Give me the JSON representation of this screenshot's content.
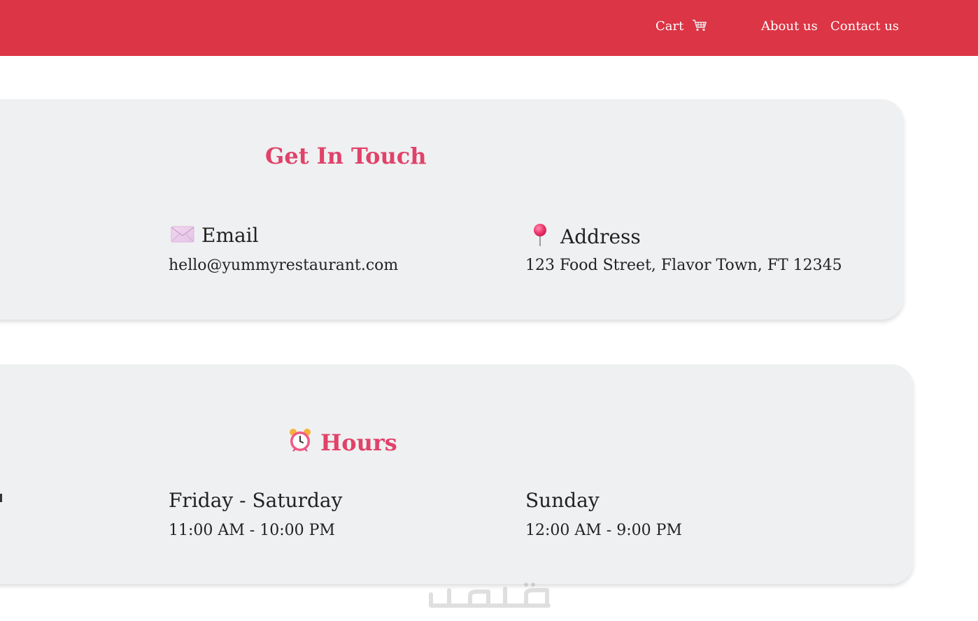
{
  "nav": {
    "cart_label": "Cart",
    "about_label": "About us",
    "contact_label": "Contact us"
  },
  "contact": {
    "title": "Get In Touch",
    "email": {
      "label": "Email",
      "value": "hello@yummyrestaurant.com"
    },
    "address": {
      "label": "Address",
      "value": "123 Food Street, Flavor Town, FT 12345"
    }
  },
  "hours": {
    "title": "Hours",
    "items": [
      {
        "days": "Friday - Saturday",
        "time": "11:00 AM - 10:00 PM"
      },
      {
        "days": "Sunday",
        "time": "12:00 AM - 9:00 PM"
      }
    ]
  },
  "icons": {
    "cart": "cart-icon",
    "email": "envelope-icon",
    "address": "pin-icon",
    "hours": "alarm-clock-icon"
  },
  "colors": {
    "navbar": "#dc3545",
    "accent": "#e0426a",
    "card_bg": "#eff0f1"
  }
}
